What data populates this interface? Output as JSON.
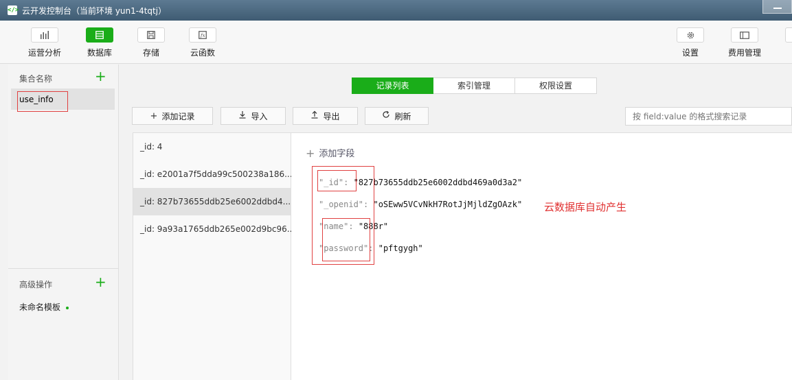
{
  "window": {
    "title": "云开发控制台（当前环境 yun1-4tqtj）"
  },
  "toolbar": {
    "left": [
      {
        "label": "运营分析",
        "icon": "bar-chart-icon"
      },
      {
        "label": "数据库",
        "icon": "database-icon"
      },
      {
        "label": "存储",
        "icon": "storage-icon"
      },
      {
        "label": "云函数",
        "icon": "function-icon"
      }
    ],
    "right": [
      {
        "label": "设置",
        "icon": "gear-icon"
      },
      {
        "label": "费用管理",
        "icon": "billing-icon"
      }
    ]
  },
  "sidebar": {
    "collections_header": "集合名称",
    "collections": [
      {
        "name": "use_info"
      }
    ],
    "advanced_header": "高级操作",
    "templates": [
      {
        "name": "未命名模板"
      }
    ]
  },
  "tabs": [
    {
      "label": "记录列表",
      "active": true
    },
    {
      "label": "索引管理",
      "active": false
    },
    {
      "label": "权限设置",
      "active": false
    }
  ],
  "actions": {
    "add": "添加记录",
    "import": "导入",
    "export": "导出",
    "refresh": "刷新",
    "search_placeholder": "按 field:value 的格式搜索记录"
  },
  "records": [
    {
      "label": "_id: 4"
    },
    {
      "label": "_id: e2001a7f5dda99c500238a186..."
    },
    {
      "label": "_id: 827b73655ddb25e6002ddbd4...",
      "selected": true
    },
    {
      "label": "_id: 9a93a1765ddb265e002d9bc96..."
    }
  ],
  "detail": {
    "add_field": "添加字段",
    "fields": [
      {
        "key": "\"_id\":",
        "value": "\"827b73655ddb25e6002ddbd469a0d3a2\""
      },
      {
        "key": "\"_openid\":",
        "value": "\"oSEww5VCvNkH7RotJjMjldZgOAzk\""
      },
      {
        "key": "\"name\":",
        "value": "\"888r\""
      },
      {
        "key": "\"password\":",
        "value": "\"pftgygh\""
      }
    ],
    "annotation": "云数据库自动产生"
  },
  "colors": {
    "accent": "#1aad19",
    "annotation": "#e03030"
  }
}
